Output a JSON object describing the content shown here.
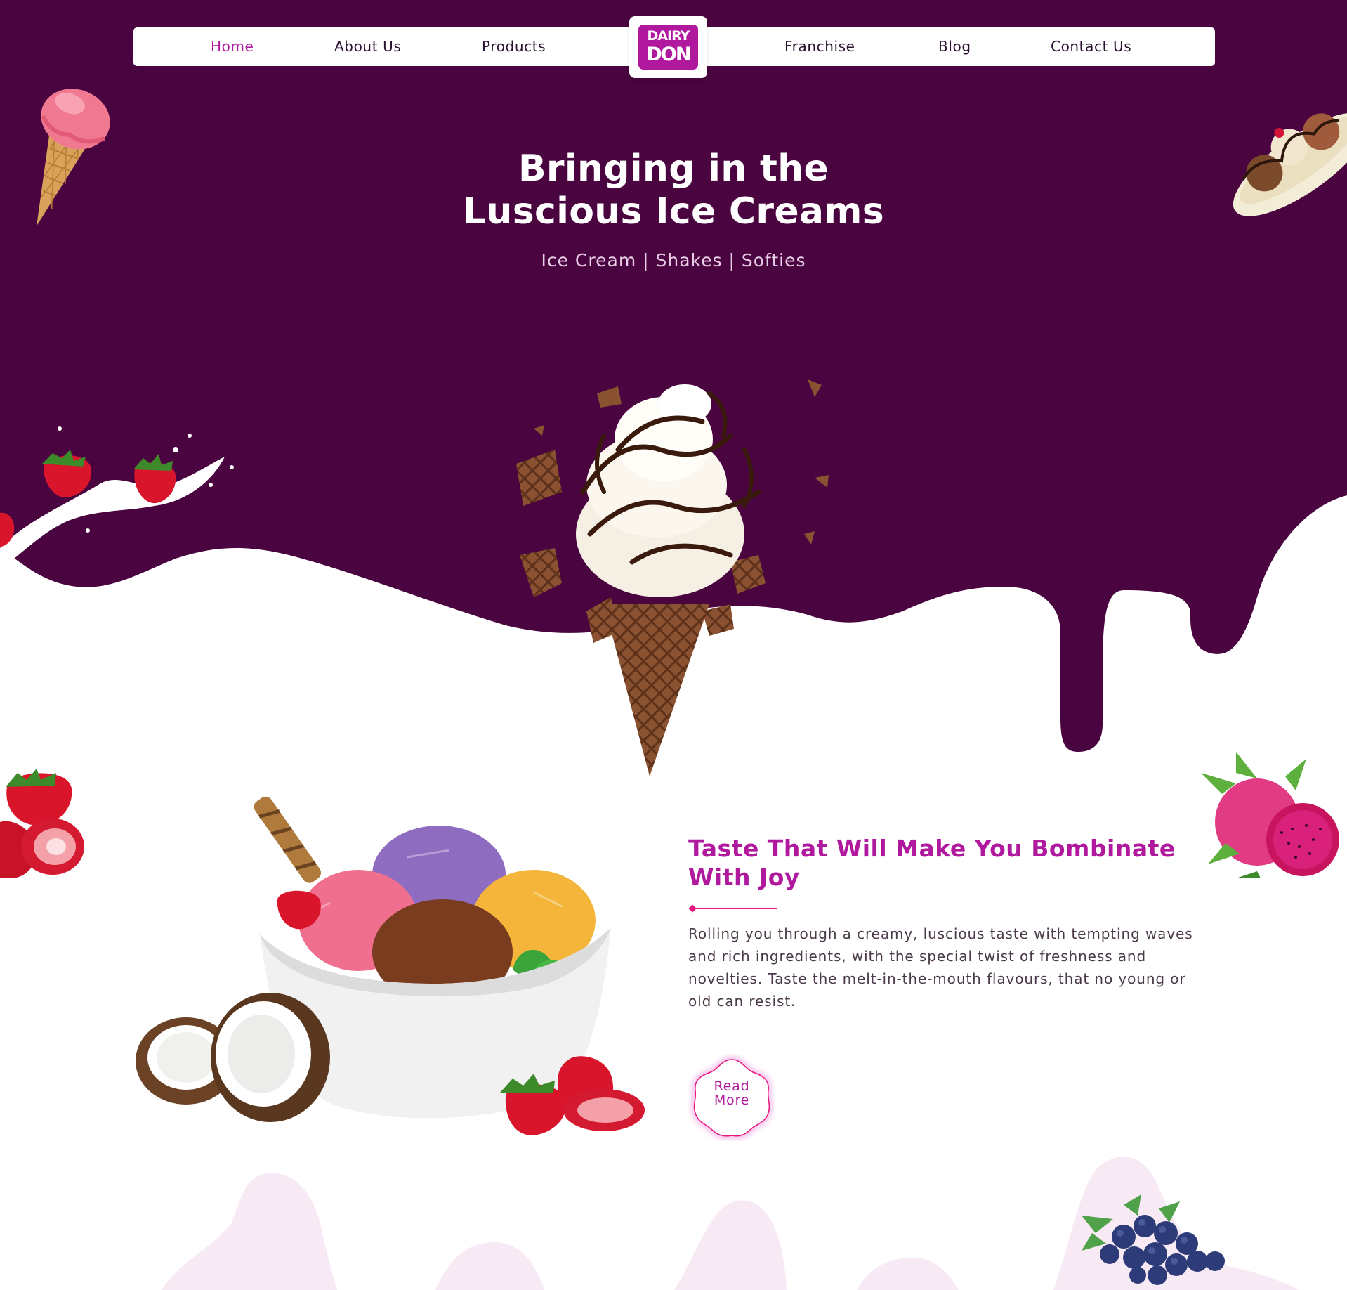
{
  "brand": {
    "logo_line1": "DAIRY",
    "logo_line2": "DON",
    "primary_color": "#4a0440",
    "accent_color": "#b0189e",
    "pink_color": "#e8157f"
  },
  "nav": {
    "items": [
      {
        "label": "Home",
        "active": true
      },
      {
        "label": "About Us",
        "active": false
      },
      {
        "label": "Products",
        "active": false
      },
      {
        "label": "Franchise",
        "active": false
      },
      {
        "label": "Blog",
        "active": false
      },
      {
        "label": "Contact Us",
        "active": false
      }
    ]
  },
  "hero": {
    "title_line1": "Bringing in the",
    "title_line2": "Luscious Ice Creams",
    "subtitle": "Ice Cream | Shakes | Softies"
  },
  "about": {
    "heading_line1": "Taste That Will Make You Bombinate",
    "heading_line2": "With Joy",
    "body_lines": [
      "Rolling you through a creamy, luscious taste with tempting waves",
      "and rich ingredients, with the special twist of freshness and",
      "novelties. Taste the melt-in-the-mouth flavours, that no young or",
      "old can resist."
    ],
    "read_more_line1": "Read",
    "read_more_line2": "More"
  },
  "images": [
    "pink-ice-cream-cone",
    "banana-split",
    "strawberry-milk-splash",
    "chocolate-soft-serve-cone",
    "strawberries",
    "dragon-fruit",
    "ice-cream-bowl",
    "coconut",
    "blueberries"
  ]
}
